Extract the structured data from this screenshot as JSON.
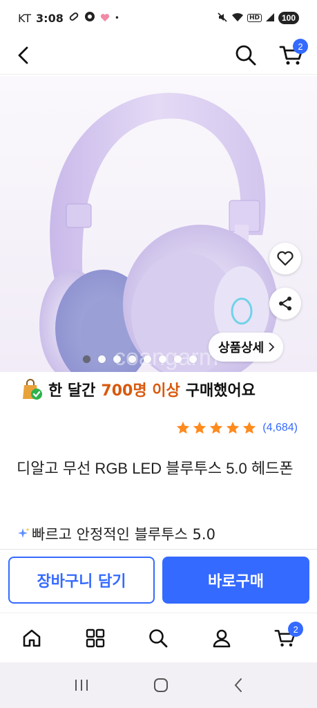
{
  "status_bar": {
    "carrier": "KT",
    "time": "3:08",
    "battery": "100",
    "dot": "•",
    "hd": "HD"
  },
  "header": {
    "back_icon": "chevron-left-icon",
    "search_icon": "search-icon",
    "cart_icon": "cart-icon",
    "cart_count": "2"
  },
  "hero": {
    "product_image": "purple-headphones",
    "watermark": "coangarm",
    "detail_label": "상품상세",
    "carousel_dot_count": 8,
    "active_dot_index": 0
  },
  "social_proof": {
    "prefix": "한 달간",
    "highlight": "700명 이상",
    "suffix": "구매했어요"
  },
  "rating": {
    "stars": 5,
    "count": "(4,684)",
    "star_color": "#ff8a1d"
  },
  "product": {
    "title": "디알고 무선 RGB LED 블루투스 5.0 헤드폰",
    "feature": "빠르고 안정적인 블루투스 5.0"
  },
  "buy_bar": {
    "add_to_cart": "장바구니 담기",
    "buy_now": "바로구매"
  },
  "bottom_nav": {
    "items": [
      "home-icon",
      "category-icon",
      "search-icon",
      "profile-icon",
      "cart-icon"
    ],
    "cart_count": "2"
  },
  "colors": {
    "accent": "#346aff",
    "highlight": "#d8590d"
  }
}
